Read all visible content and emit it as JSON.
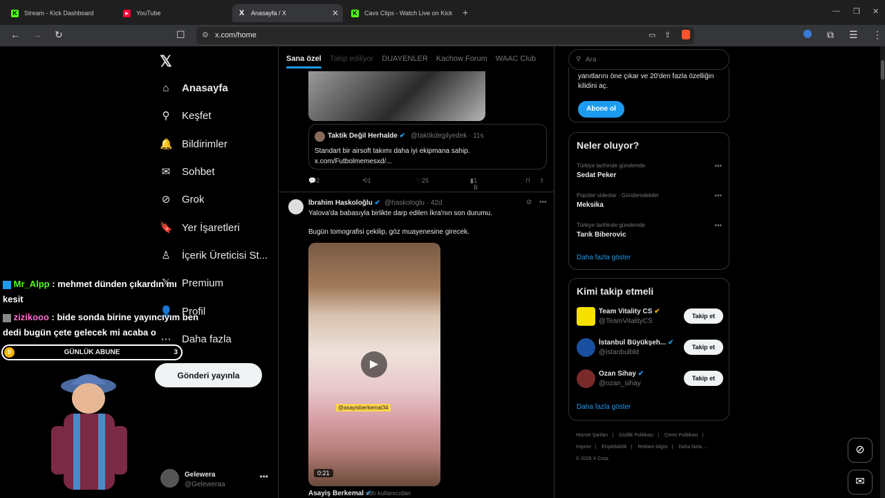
{
  "browser": {
    "tabs": [
      {
        "title": "Stream - Kick Dashboard",
        "active": false
      },
      {
        "title": "YouTube",
        "active": false
      },
      {
        "title": "Anasayfa / X",
        "active": true
      },
      {
        "title": "Cavs Clips - Watch Live on Kick",
        "active": false
      }
    ],
    "url": "x.com/home"
  },
  "sidebar": {
    "items": [
      {
        "label": "Anasayfa",
        "icon": "home-icon",
        "glyph": "⌂"
      },
      {
        "label": "Keşfet",
        "icon": "search-icon",
        "glyph": "⚲"
      },
      {
        "label": "Bildirimler",
        "icon": "bell-icon",
        "glyph": "🔔"
      },
      {
        "label": "Sohbet",
        "icon": "mail-icon",
        "glyph": "✉"
      },
      {
        "label": "Grok",
        "icon": "grok-icon",
        "glyph": "⊘"
      },
      {
        "label": "Yer İşaretleri",
        "icon": "bookmark-icon",
        "glyph": "🔖"
      },
      {
        "label": "İçerik Üreticisi St...",
        "icon": "creator-icon",
        "glyph": "♙"
      },
      {
        "label": "Premium",
        "icon": "x-premium-icon",
        "glyph": "𝕏"
      },
      {
        "label": "Profil",
        "icon": "profile-icon",
        "glyph": "👤"
      },
      {
        "label": "Daha fazla",
        "icon": "more-icon",
        "glyph": "⋯"
      }
    ],
    "post_button": "Gönderi yayınla",
    "account": {
      "name": "Gelewera",
      "handle": "@Geleweraa"
    }
  },
  "overlay": {
    "chat": [
      {
        "user": "Mr_Alpp",
        "message": ": mehmet dünden çıkardın mı kesit"
      },
      {
        "user": "zizikooo",
        "message": ": bide sonda birine yayıncıyım ben dedi bugün çete gelecek mi acaba o"
      }
    ],
    "sub_goal": {
      "label": "GÜNLÜK ABUNE",
      "current": "0",
      "target": "3"
    }
  },
  "feed": {
    "tabs": [
      "Sana özel",
      "Takip ediliyor",
      "DUAYENLER",
      "Kachow Forum",
      "WAAC Club"
    ],
    "quote": {
      "name": "Taktik Değil Herhalde",
      "handle": "@taktikdegilyedek · 11s",
      "text": "Standart bir airsoft takımı daha iyi ekipmana sahip. x.com/Futbolmemesxd/..."
    },
    "actions": {
      "replies": "2",
      "reposts": "1",
      "likes": "25",
      "views": "1 B"
    },
    "tweet2": {
      "name": "İbrahim Haskoloğlu",
      "handle": "@haskologlu · 42d",
      "line1": "Yalova'da babasıyla birlikte darp edilen İkra'nın son durumu.",
      "line2": "Bugün tomografisi çekilip, göz muayenesine girecek.",
      "video_tag": "@asayisberkemal34",
      "duration": "0:21",
      "credit_name": "Asayiş Berkemal",
      "credit_sub": "adlı kullanıcıdan"
    }
  },
  "right": {
    "search_placeholder": "Ara",
    "premium_text": "yanıtlarını öne çıkar ve 20'den fazla özelliğin kilidini aç.",
    "premium_button": "Abone ol",
    "trends_title": "Neler oluyor?",
    "trends": [
      {
        "context": "Türkiye tarihinde gündemde",
        "title": "Sedat Peker"
      },
      {
        "context": "Popüler videolar · Gündemdekiler",
        "title": "Meksika"
      },
      {
        "context": "Türkiye tarihinde gündemde",
        "title": "Tarık Biberovic"
      }
    ],
    "show_more": "Daha fazla göster",
    "follow_title": "Kimi takip etmeli",
    "follow": [
      {
        "name": "Team Vitality CS",
        "handle": "@TeamVitalityCS",
        "color": "#f5e000"
      },
      {
        "name": "İstanbul Büyükşeh...",
        "handle": "@istanbulbld",
        "color": "#1a4fa0"
      },
      {
        "name": "Ozan Sihay",
        "handle": "@ozan_sihay",
        "color": "#7a2a2a"
      }
    ],
    "follow_button": "Takip et",
    "follow_more": "Daha fazla göster",
    "footer": [
      "Hizmet Şartları",
      "|",
      "Gizlilik Politikası",
      "|",
      "Çerez Politikası",
      "|",
      "Imprint",
      "|",
      "Erişilebilirlik",
      "|",
      "Reklam bilgisi",
      "|",
      "Daha fazla ...",
      "© 2026 X Corp."
    ]
  }
}
